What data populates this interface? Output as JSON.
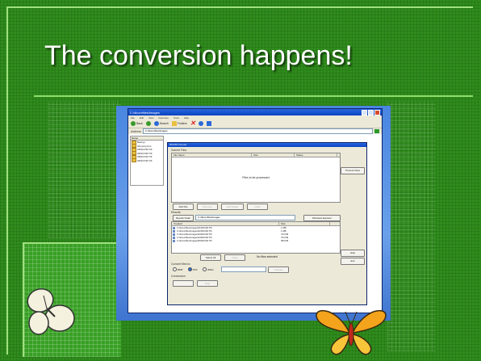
{
  "slide": {
    "title": "The conversion happens!",
    "colors": {
      "background": "#2f8c1c",
      "accent_line": "#9fe07e",
      "title_text": "#ffffff"
    }
  },
  "screenshot": {
    "window_title": "C:\\dicomfiles\\images",
    "menu": [
      "File",
      "Edit",
      "View",
      "Favorites",
      "Tools",
      "Help"
    ],
    "toolbar": {
      "back": "Back",
      "search": "Search",
      "folders": "Folders"
    },
    "address": {
      "label": "Address",
      "value": "C:\\dicomfiles\\images"
    },
    "folders": {
      "header": "Name",
      "items": [
        "Back.jp",
        "01(new).dcm",
        "01DICOM.TIF",
        "02DICOM.TIF",
        "03DICOM.TIF",
        "04DICOM.TIF"
      ]
    },
    "dialog": {
      "title": "DICOM Convert",
      "submit_section": "Submit Files",
      "columns": [
        "File Name",
        "Size",
        "Status"
      ],
      "empty_text": "Files to be processed",
      "buttons": {
        "add_file": "Add File",
        "remove": "Remove",
        "add_folder": "Add Folder",
        "clear": "Clear",
        "process": "Process Files"
      },
      "results_section": "Results",
      "results_folder_button": "Results folder",
      "results_folder_value": "C:\\dicomfiles\\images",
      "windows_explorer": "Windows Explorer",
      "results_columns": [
        "Created",
        "Size"
      ],
      "results": [
        {
          "name": "C:\\dicomfiles\\images\\01DICOM.TIF",
          "size": "1 MB"
        },
        {
          "name": "C:\\dicomfiles\\images\\02DICOM.TIF",
          "size": "1 MB"
        },
        {
          "name": "C:\\dicomfiles\\images\\03DICOM.TIF",
          "size": "724 KB"
        },
        {
          "name": "C:\\dicomfiles\\images\\04DICOM.TIF",
          "size": "764 KB"
        },
        {
          "name": "C:\\dicomfiles\\images\\05DICOM.TIF",
          "size": "909 KB"
        }
      ],
      "select_all": "Select All",
      "clear2": "Clear",
      "no_files": "No files selected",
      "convert_label": "Convert files to:",
      "formats": [
        "BMP",
        "TIFF",
        "JPEG"
      ],
      "selected_format": "TIFF",
      "convert_button": "Convert",
      "conversion_section": "Conversion",
      "stop_button": "Stop",
      "help_button": "Help",
      "exit_button": "Exit"
    }
  }
}
